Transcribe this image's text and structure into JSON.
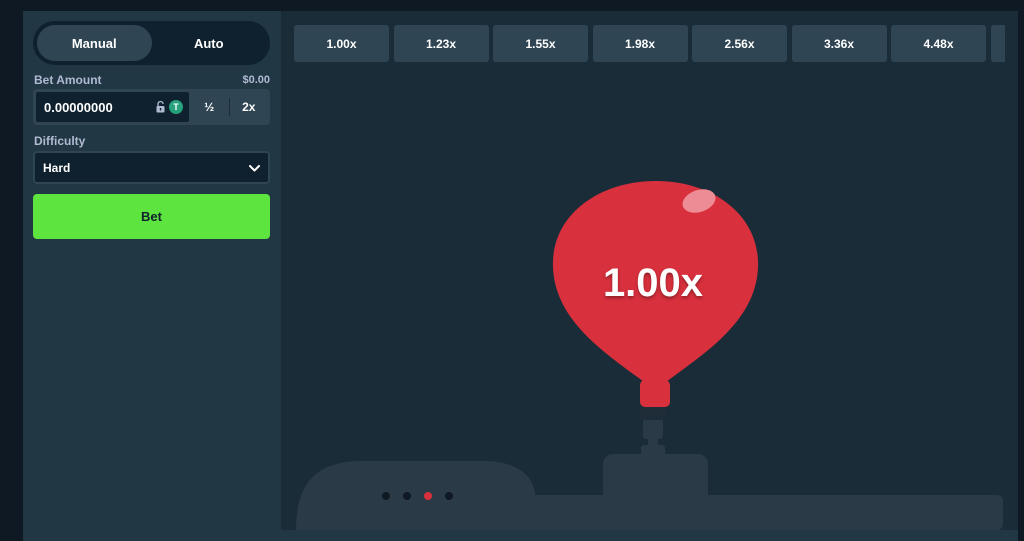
{
  "sidebar": {
    "tabs": [
      {
        "label": "Manual",
        "active": true
      },
      {
        "label": "Auto",
        "active": false
      }
    ],
    "bet_amount": {
      "label": "Bet Amount",
      "usd_value": "$0.00",
      "value": "0.00000000",
      "currency_icon": "tether-coin-icon",
      "half_label": "½",
      "double_label": "2x"
    },
    "difficulty": {
      "label": "Difficulty",
      "selected": "Hard"
    },
    "bet_button": "Bet"
  },
  "multipliers": [
    "1.00x",
    "1.23x",
    "1.55x",
    "1.98x",
    "2.56x",
    "3.36x",
    "4.48x"
  ],
  "game": {
    "balloon_multiplier": "1.00x",
    "pager": {
      "count": 4,
      "active_index": 2
    }
  },
  "colors": {
    "background": "#1a2c38",
    "sidebar": "#213743",
    "accent_green": "#5de43f",
    "balloon_red": "#d8303d",
    "pump_dark": "#2b3a47"
  }
}
